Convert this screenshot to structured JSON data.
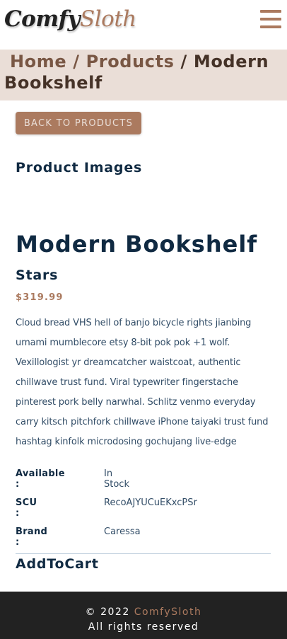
{
  "navbar": {
    "logo_part1": "Comfy",
    "logo_part2": "Sloth",
    "menu_icon": "hamburger-menu-icon"
  },
  "breadcrumb": {
    "home": "Home",
    "products": "Products",
    "separator": "/",
    "current": "Modern Bookshelf"
  },
  "back_button": "BACK TO PRODUCTS",
  "product": {
    "images_heading": "Product Images",
    "name": "Modern Bookshelf",
    "stars_label": "Stars",
    "price": "$319.99",
    "description": "Cloud bread VHS hell of banjo bicycle rights jianbing umami mumblecore etsy 8-bit pok pok +1 wolf. Vexillologist yr dreamcatcher waistcoat, authentic chillwave trust fund. Viral typewriter fingerstache pinterest pork belly narwhal. Schlitz venmo everyday carry kitsch pitchfork chillwave iPhone taiyaki trust fund hashtag kinfolk microdosing gochujang live-edge",
    "info": [
      {
        "label": "Available :",
        "value": "In Stock"
      },
      {
        "label": "SCU :",
        "value": "RecoAJYUCuEKxcPSr"
      },
      {
        "label": "Brand :",
        "value": "Caressa"
      }
    ],
    "add_to_cart": "AddToCart"
  },
  "footer": {
    "copyright_prefix": "© 2022",
    "brand": "ComfySloth",
    "rights": "All rights reserved"
  },
  "colors": {
    "primary": "#ab7a5f",
    "hero_bg": "#eaded7",
    "text_dark": "#102a42",
    "footer_bg": "#222222"
  }
}
